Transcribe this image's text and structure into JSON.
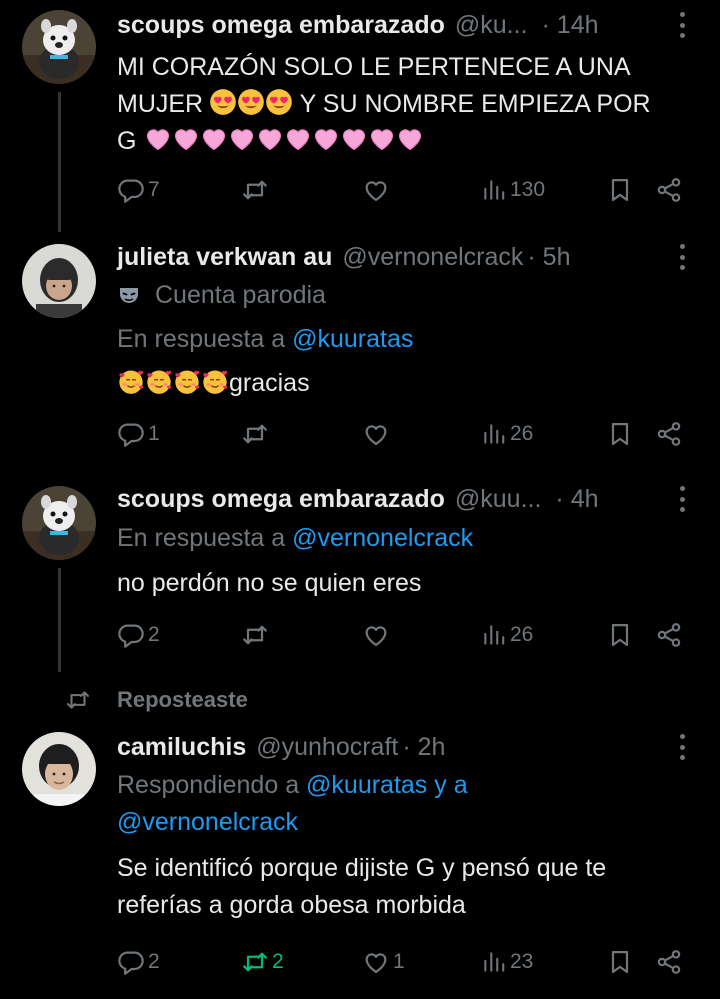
{
  "colors": {
    "background": "#000000",
    "text": "#e7e9ea",
    "muted": "#71767b",
    "link": "#1d9bf0",
    "retweet_active": "#00ba7c"
  },
  "posts": [
    {
      "name": "scoups omega embarazado",
      "handle": "@ku...",
      "time": "· 14h",
      "text_line1": "MI CORAZÓN SOLO LE PERTENECE A UNA",
      "text_line2a": "MUJER",
      "text_line2b": " Y SU NOMBRE EMPIEZA POR",
      "text_line3": "G",
      "emojis_line2": [
        "heart-eyes-emoji",
        "heart-eyes-emoji",
        "heart-eyes-emoji"
      ],
      "emojis_line3_count": 10,
      "replies": "7",
      "reposts": "",
      "likes": "",
      "views": "130"
    },
    {
      "name": "julieta verkwan au",
      "handle": "@vernonelcrack",
      "time": "· 5h",
      "parody_label": "Cuenta parodia",
      "reply_prefix": "En respuesta a ",
      "reply_to": "@kuuratas",
      "text": "gracias",
      "replies": "1",
      "reposts": "",
      "likes": "",
      "views": "26"
    },
    {
      "name": "scoups omega embarazado",
      "handle": "@kuu...",
      "time": "· 4h",
      "reply_prefix": "En respuesta a ",
      "reply_to": "@vernonelcrack",
      "text": "no perdón no se quien eres",
      "replies": "2",
      "reposts": "",
      "likes": "",
      "views": "26"
    },
    {
      "repost_label": "Reposteaste",
      "name": "camiluchis",
      "handle": "@yunhocraft",
      "time": "· 2h",
      "reply_prefix": "Respondiendo a ",
      "reply_to_1": "@kuuratas",
      "reply_and": " y a",
      "reply_to_2": "@vernonelcrack",
      "text_line1": "Se identificó porque dijiste G y pensó que te",
      "text_line2": "referías a gorda obesa morbida",
      "replies": "2",
      "reposts": "2",
      "likes": "1",
      "views": "23"
    }
  ]
}
